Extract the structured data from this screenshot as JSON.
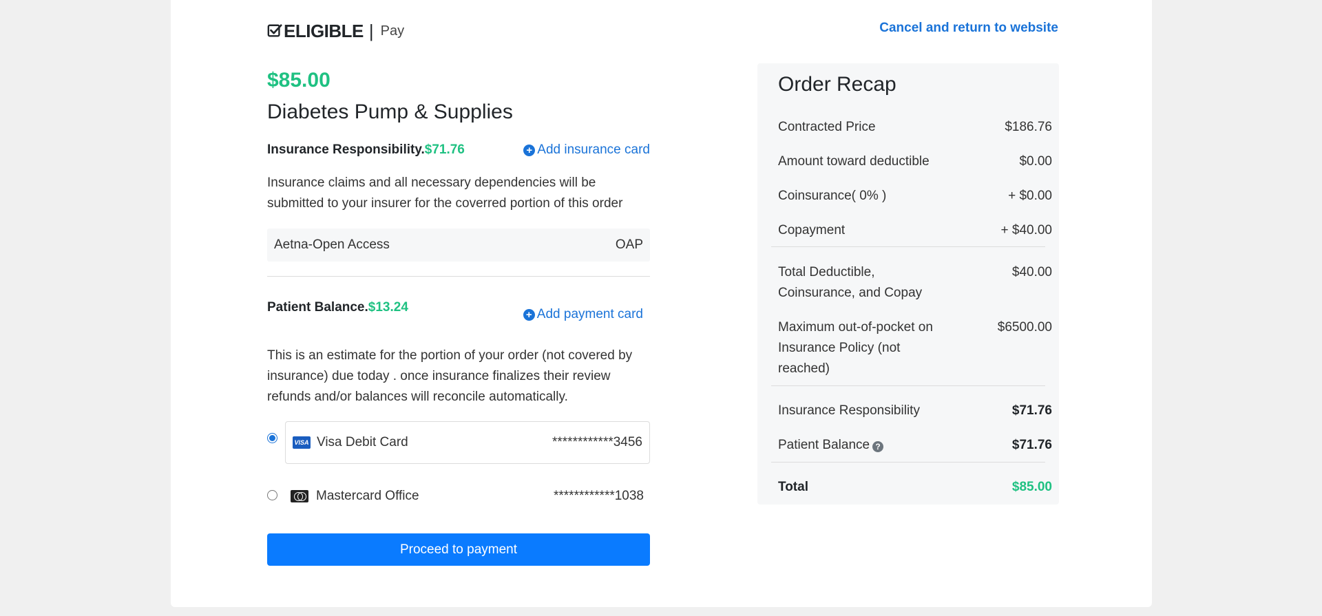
{
  "header": {
    "brand_name": "ELIGIBLE",
    "brand_separator": "|",
    "brand_suffix": "Pay",
    "cancel_link": "Cancel and return to website"
  },
  "order": {
    "price": "$85.00",
    "product_name": "Diabetes Pump & Supplies"
  },
  "insurance": {
    "label": "Insurance Responsibility.",
    "amount": "$71.76",
    "add_card_link": "Add insurance card",
    "description": "Insurance claims and all necessary dependencies will be submitted to your insurer for the coverred portion of this order",
    "plan_name": "Aetna-Open Access",
    "plan_code": "OAP"
  },
  "patient": {
    "label": "Patient Balance.",
    "amount": "$13.24",
    "add_card_link": "Add payment card",
    "description": "This is an estimate for the portion of your order (not covered by insurance) due today . once insurance finalizes their review refunds and/or balances will reconcile automatically."
  },
  "payment_methods": [
    {
      "name": "Visa Debit Card",
      "number": "************3456",
      "selected": true,
      "icon": "visa-card-icon",
      "icon_text": "VISA"
    },
    {
      "name": "Mastercard Office",
      "number": "************1038",
      "selected": false,
      "icon": "mastercard-icon"
    }
  ],
  "proceed_button": "Proceed to payment",
  "recap": {
    "title": "Order Recap",
    "rows": [
      {
        "label": "Contracted Price",
        "value": "$186.76"
      },
      {
        "label": "Amount toward deductible",
        "value": "$0.00"
      },
      {
        "label": "Coinsurance( 0% )",
        "value": "+ $0.00"
      },
      {
        "label": "Copayment",
        "value": "+ $40.00"
      },
      {
        "label": "Total Deductible, Coinsurance, and Copay",
        "value": "$40.00"
      },
      {
        "label": "Maximum out-of-pocket on Insurance Policy (not reached)",
        "value": "$6500.00"
      },
      {
        "label": "Insurance Responsibility",
        "value": "$71.76"
      },
      {
        "label": "Patient Balance",
        "value": "$71.76"
      },
      {
        "label": "Total",
        "value": "$85.00"
      }
    ]
  },
  "colors": {
    "accent_green": "#1fc182",
    "link_blue": "#1a73d8",
    "button_blue": "#0a7bff"
  }
}
